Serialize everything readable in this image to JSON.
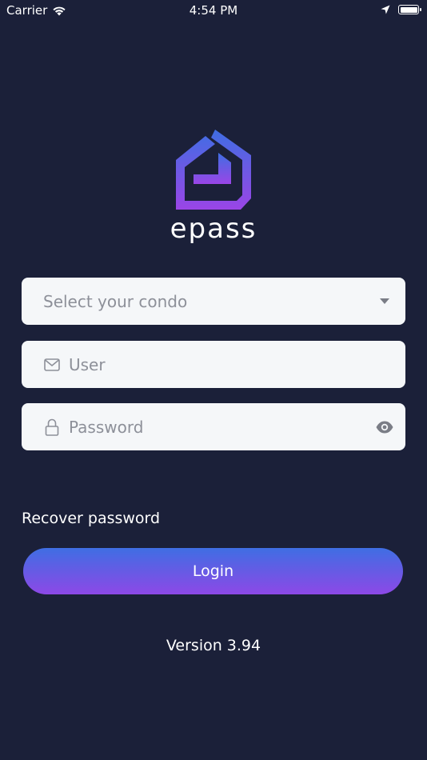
{
  "status_bar": {
    "carrier": "Carrier",
    "time": "4:54 PM",
    "icons": [
      "wifi-icon",
      "location-icon",
      "battery-icon"
    ]
  },
  "brand": {
    "name": "epass",
    "logo_icon": "house-logo-icon",
    "logo_colors": [
      "#3f6ee3",
      "#9a45e6"
    ]
  },
  "form": {
    "condo_select": {
      "placeholder": "Select your condo",
      "icon": "chevron-down-icon"
    },
    "user_field": {
      "placeholder": "User",
      "icon": "envelope-icon"
    },
    "password_field": {
      "placeholder": "Password",
      "icon": "lock-icon",
      "toggle_icon": "eye-icon"
    }
  },
  "actions": {
    "recover_label": "Recover password",
    "login_label": "Login"
  },
  "footer": {
    "version": "Version 3.94"
  },
  "colors": {
    "background": "#1b2039",
    "field_background": "#f5f7f9",
    "placeholder": "#8d9099",
    "button_gradient_top": "#3f6ee3",
    "button_gradient_bottom": "#8d48e6"
  }
}
